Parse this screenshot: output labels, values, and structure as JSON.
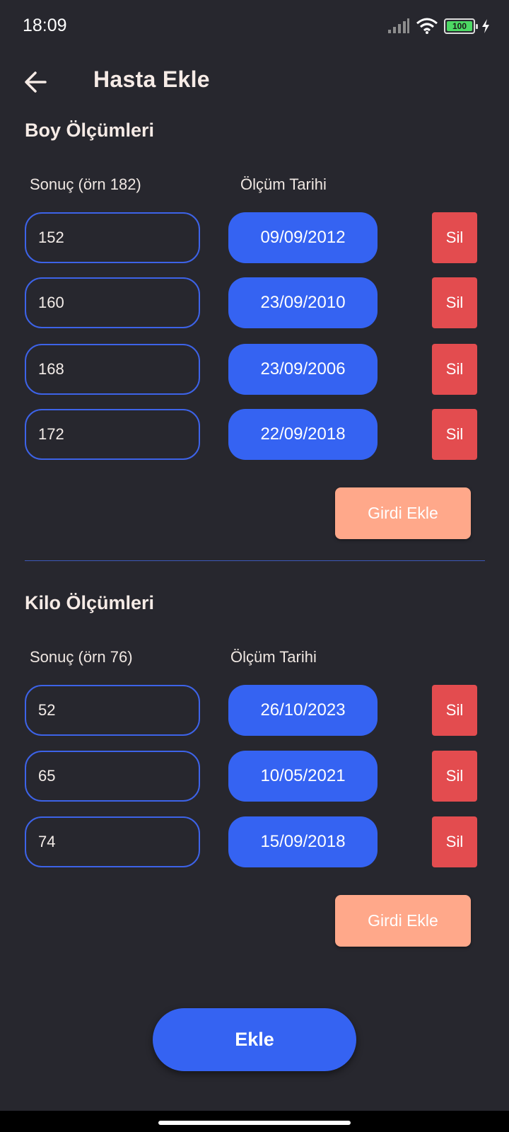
{
  "status_bar": {
    "time": "18:09",
    "battery_level": "100",
    "icons": [
      "signal-icon",
      "wifi-icon",
      "battery-icon",
      "charging-icon"
    ]
  },
  "app_bar": {
    "title": "Hasta Ekle",
    "back_icon": "arrow-left-icon"
  },
  "height_section": {
    "title": "Boy Ölçümleri",
    "result_label": "Sonuç (örn 182)",
    "date_label": "Ölçüm Tarihi",
    "entries": [
      {
        "value": "152",
        "date": "09/09/2012",
        "delete_label": "Sil"
      },
      {
        "value": "160",
        "date": "23/09/2010",
        "delete_label": "Sil"
      },
      {
        "value": "168",
        "date": "23/09/2006",
        "delete_label": "Sil"
      },
      {
        "value": "172",
        "date": "22/09/2018",
        "delete_label": "Sil"
      }
    ],
    "add_entry_label": "Girdi Ekle"
  },
  "weight_section": {
    "title": "Kilo Ölçümleri",
    "result_label": "Sonuç (örn 76)",
    "date_label": "Ölçüm Tarihi",
    "entries": [
      {
        "value": "52",
        "date": "26/10/2023",
        "delete_label": "Sil"
      },
      {
        "value": "65",
        "date": "10/05/2021",
        "delete_label": "Sil"
      },
      {
        "value": "74",
        "date": "15/09/2018",
        "delete_label": "Sil"
      }
    ],
    "add_entry_label": "Girdi Ekle"
  },
  "submit_label": "Ekle",
  "colors": {
    "background": "#27272e",
    "primary": "#3563f2",
    "delete": "#e34c4f",
    "add_entry": "#ffa88a"
  }
}
